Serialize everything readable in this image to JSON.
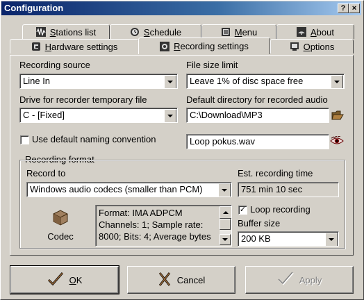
{
  "window": {
    "title": "Configuration",
    "help_label": "?",
    "close_label": "×"
  },
  "tabs_row1": [
    {
      "label": "Stations list",
      "mnemonic": "S",
      "rest": "tations list",
      "icon": "waveform-icon"
    },
    {
      "label": "Schedule",
      "mnemonic": "S",
      "rest": "chedule",
      "icon": "clock-icon"
    },
    {
      "label": "Menu",
      "mnemonic": "M",
      "rest": "enu",
      "icon": "menu-icon"
    },
    {
      "label": "About",
      "mnemonic": "A",
      "rest": "bout",
      "icon": "broadcast-icon"
    }
  ],
  "tabs_row2": [
    {
      "label": "Hardware settings",
      "mnemonic": "H",
      "rest": "ardware settings",
      "icon": "hardware-icon"
    },
    {
      "label": "Recording settings",
      "mnemonic": "R",
      "rest": "ecording settings",
      "icon": "record-icon",
      "active": true
    },
    {
      "label": "Options",
      "mnemonic": "O",
      "rest": "ptions",
      "icon": "options-icon"
    }
  ],
  "recording_source": {
    "label": "Recording source",
    "value": "Line In"
  },
  "file_size_limit": {
    "label": "File size limit",
    "value": "Leave 1% of disc space free"
  },
  "drive": {
    "label": "Drive for recorder temporary file",
    "value": "C - [Fixed]"
  },
  "default_directory": {
    "label": "Default directory for recorded audio",
    "value": "C:\\Download\\MP3"
  },
  "naming": {
    "label": "Use default naming convention",
    "checked": false
  },
  "filename": {
    "value": "Loop pokus.wav"
  },
  "recording_format": {
    "group_label": "Recording format",
    "record_to_label": "Record to",
    "record_to_value": "Windows audio codecs (smaller than PCM)",
    "est_time_label": "Est. recording time",
    "est_time_value": "751 min 10 sec",
    "codec_label": "Codec",
    "codec_info": [
      "Format: IMA ADPCM",
      "Channels: 1; Sample rate:",
      "8000; Bits: 4; Average bytes"
    ],
    "loop_label": "Loop recording",
    "loop_checked": true,
    "buffer_label": "Buffer size",
    "buffer_value": "200 KB"
  },
  "buttons": {
    "ok": {
      "mnemonic": "O",
      "rest": "K"
    },
    "cancel": "Cancel",
    "apply": "Apply"
  }
}
